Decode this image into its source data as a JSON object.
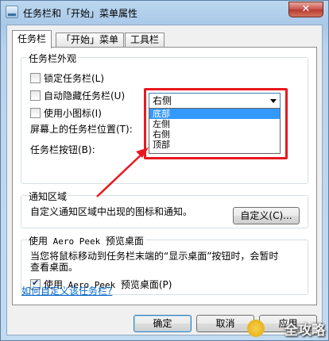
{
  "window": {
    "title": "任务栏和「开始」菜单属性",
    "close_label": "✕"
  },
  "tabs": [
    {
      "label": "任务栏"
    },
    {
      "label": "「开始」菜单"
    },
    {
      "label": "工具栏"
    }
  ],
  "appearance": {
    "group_label": "任务栏外观",
    "lock_taskbar": "锁定任务栏(L)",
    "auto_hide": "自动隐藏任务栏(U)",
    "small_icons": "使用小图标(I)",
    "location_label": "屏幕上的任务栏位置(T):",
    "location_value": "右侧",
    "location_options": [
      "底部",
      "左侧",
      "右侧",
      "顶部"
    ],
    "buttons_label": "任务栏按钮(B):"
  },
  "notification": {
    "group_label": "通知区域",
    "description": "自定义通知区域中出现的图标和通知。",
    "customize_button": "自定义(C)..."
  },
  "aero": {
    "group_label_prefix": "使用",
    "group_label_mono": " Aero Peek ",
    "group_label_suffix": "预览桌面",
    "description_line1": "当您将鼠标移动到任务栏末端的“显示桌面”按钮时，会暂时",
    "description_line2": "查看桌面。",
    "checkbox_prefix": "使用",
    "checkbox_mono": " Aero Peek ",
    "checkbox_suffix": "预览桌面(P)"
  },
  "help_link": "如何自定义该任务栏?",
  "footer": {
    "ok": "确定",
    "cancel": "取消",
    "apply": "应用"
  },
  "watermark": "全攻略",
  "colors": {
    "highlight": "#e8191f",
    "selection": "#3399ff",
    "link": "#0066cc"
  }
}
